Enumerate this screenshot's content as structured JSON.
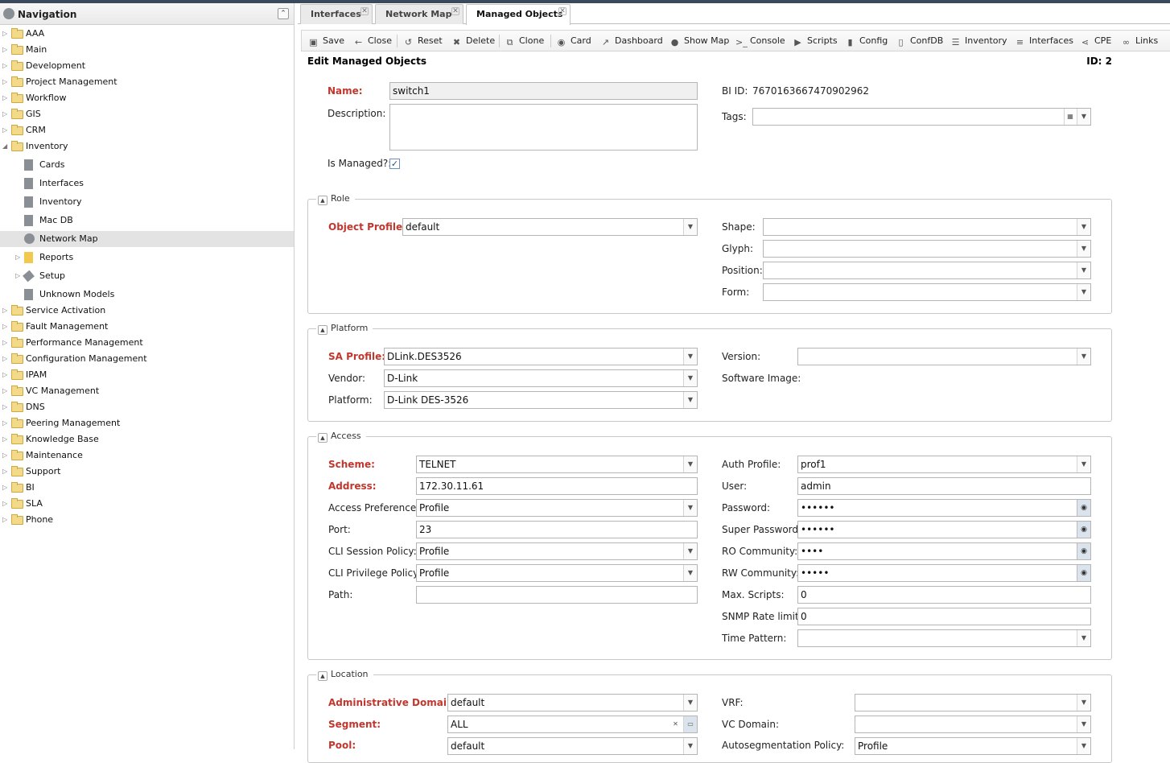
{
  "nav": {
    "title": "Navigation",
    "items": [
      {
        "label": "AAA"
      },
      {
        "label": "Main"
      },
      {
        "label": "Development"
      },
      {
        "label": "Project Management"
      },
      {
        "label": "Workflow"
      },
      {
        "label": "GIS"
      },
      {
        "label": "CRM"
      },
      {
        "label": "Inventory"
      },
      {
        "label": "Cards"
      },
      {
        "label": "Interfaces"
      },
      {
        "label": "Inventory"
      },
      {
        "label": "Mac DB"
      },
      {
        "label": "Network Map"
      },
      {
        "label": "Reports"
      },
      {
        "label": "Setup"
      },
      {
        "label": "Unknown Models"
      },
      {
        "label": "Service Activation"
      },
      {
        "label": "Fault Management"
      },
      {
        "label": "Performance Management"
      },
      {
        "label": "Configuration Management"
      },
      {
        "label": "IPAM"
      },
      {
        "label": "VC Management"
      },
      {
        "label": "DNS"
      },
      {
        "label": "Peering Management"
      },
      {
        "label": "Knowledge Base"
      },
      {
        "label": "Maintenance"
      },
      {
        "label": "Support"
      },
      {
        "label": "BI"
      },
      {
        "label": "SLA"
      },
      {
        "label": "Phone"
      }
    ]
  },
  "tabs": [
    {
      "label": "Interfaces"
    },
    {
      "label": "Network Map"
    },
    {
      "label": "Managed Objects"
    }
  ],
  "toolbar": {
    "save": "Save",
    "close": "Close",
    "reset": "Reset",
    "delete": "Delete",
    "clone": "Clone",
    "card": "Card",
    "dashboard": "Dashboard",
    "show_map": "Show Map",
    "console": "Console",
    "scripts": "Scripts",
    "config": "Config",
    "confdb": "ConfDB",
    "inventory": "Inventory",
    "interfaces": "Interfaces",
    "cpe": "CPE",
    "links": "Links"
  },
  "form": {
    "title": "Edit Managed Objects",
    "id_label": "ID: 2",
    "name_label": "Name:",
    "name_value": "switch1",
    "description_label": "Description:",
    "bi_id_label": "BI ID:",
    "bi_id_value": "7670163667470902962",
    "tags_label": "Tags:",
    "is_managed_label": "Is Managed?:",
    "role": {
      "legend": "Role",
      "object_profile_label": "Object Profile:",
      "object_profile_value": "default",
      "shape_label": "Shape:",
      "glyph_label": "Glyph:",
      "position_label": "Position:",
      "form_label": "Form:"
    },
    "platform": {
      "legend": "Platform",
      "sa_profile_label": "SA Profile:",
      "sa_profile_value": "DLink.DES3526",
      "vendor_label": "Vendor:",
      "vendor_value": "D-Link",
      "platform_label": "Platform:",
      "platform_value": "D-Link DES-3526",
      "version_label": "Version:",
      "software_image_label": "Software Image:"
    },
    "access": {
      "legend": "Access",
      "scheme_label": "Scheme:",
      "scheme_value": "TELNET",
      "address_label": "Address:",
      "address_value": "172.30.11.61",
      "access_pref_label": "Access Preference:",
      "access_pref_value": "Profile",
      "port_label": "Port:",
      "port_value": "23",
      "cli_session_label": "CLI Session Policy:",
      "cli_session_value": "Profile",
      "cli_privilege_label": "CLI Privilege Policy:",
      "cli_privilege_value": "Profile",
      "path_label": "Path:",
      "auth_profile_label": "Auth Profile:",
      "auth_profile_value": "prof1",
      "user_label": "User:",
      "user_value": "admin",
      "password_label": "Password:",
      "password_value": "••••••",
      "super_password_label": "Super Password:",
      "super_password_value": "••••••",
      "ro_community_label": "RO Community:",
      "ro_community_value": "••••",
      "rw_community_label": "RW Community:",
      "rw_community_value": "•••••",
      "max_scripts_label": "Max. Scripts:",
      "max_scripts_value": "0",
      "snmp_rate_label": "SNMP Rate limit:",
      "snmp_rate_value": "0",
      "time_pattern_label": "Time Pattern:"
    },
    "location": {
      "legend": "Location",
      "admin_domain_label": "Administrative Domain:",
      "admin_domain_value": "default",
      "segment_label": "Segment:",
      "segment_value": "ALL",
      "pool_label": "Pool:",
      "pool_value": "default",
      "vrf_label": "VRF:",
      "vc_domain_label": "VC Domain:",
      "autoseg_label": "Autosegmentation Policy:",
      "autoseg_value": "Profile"
    }
  }
}
